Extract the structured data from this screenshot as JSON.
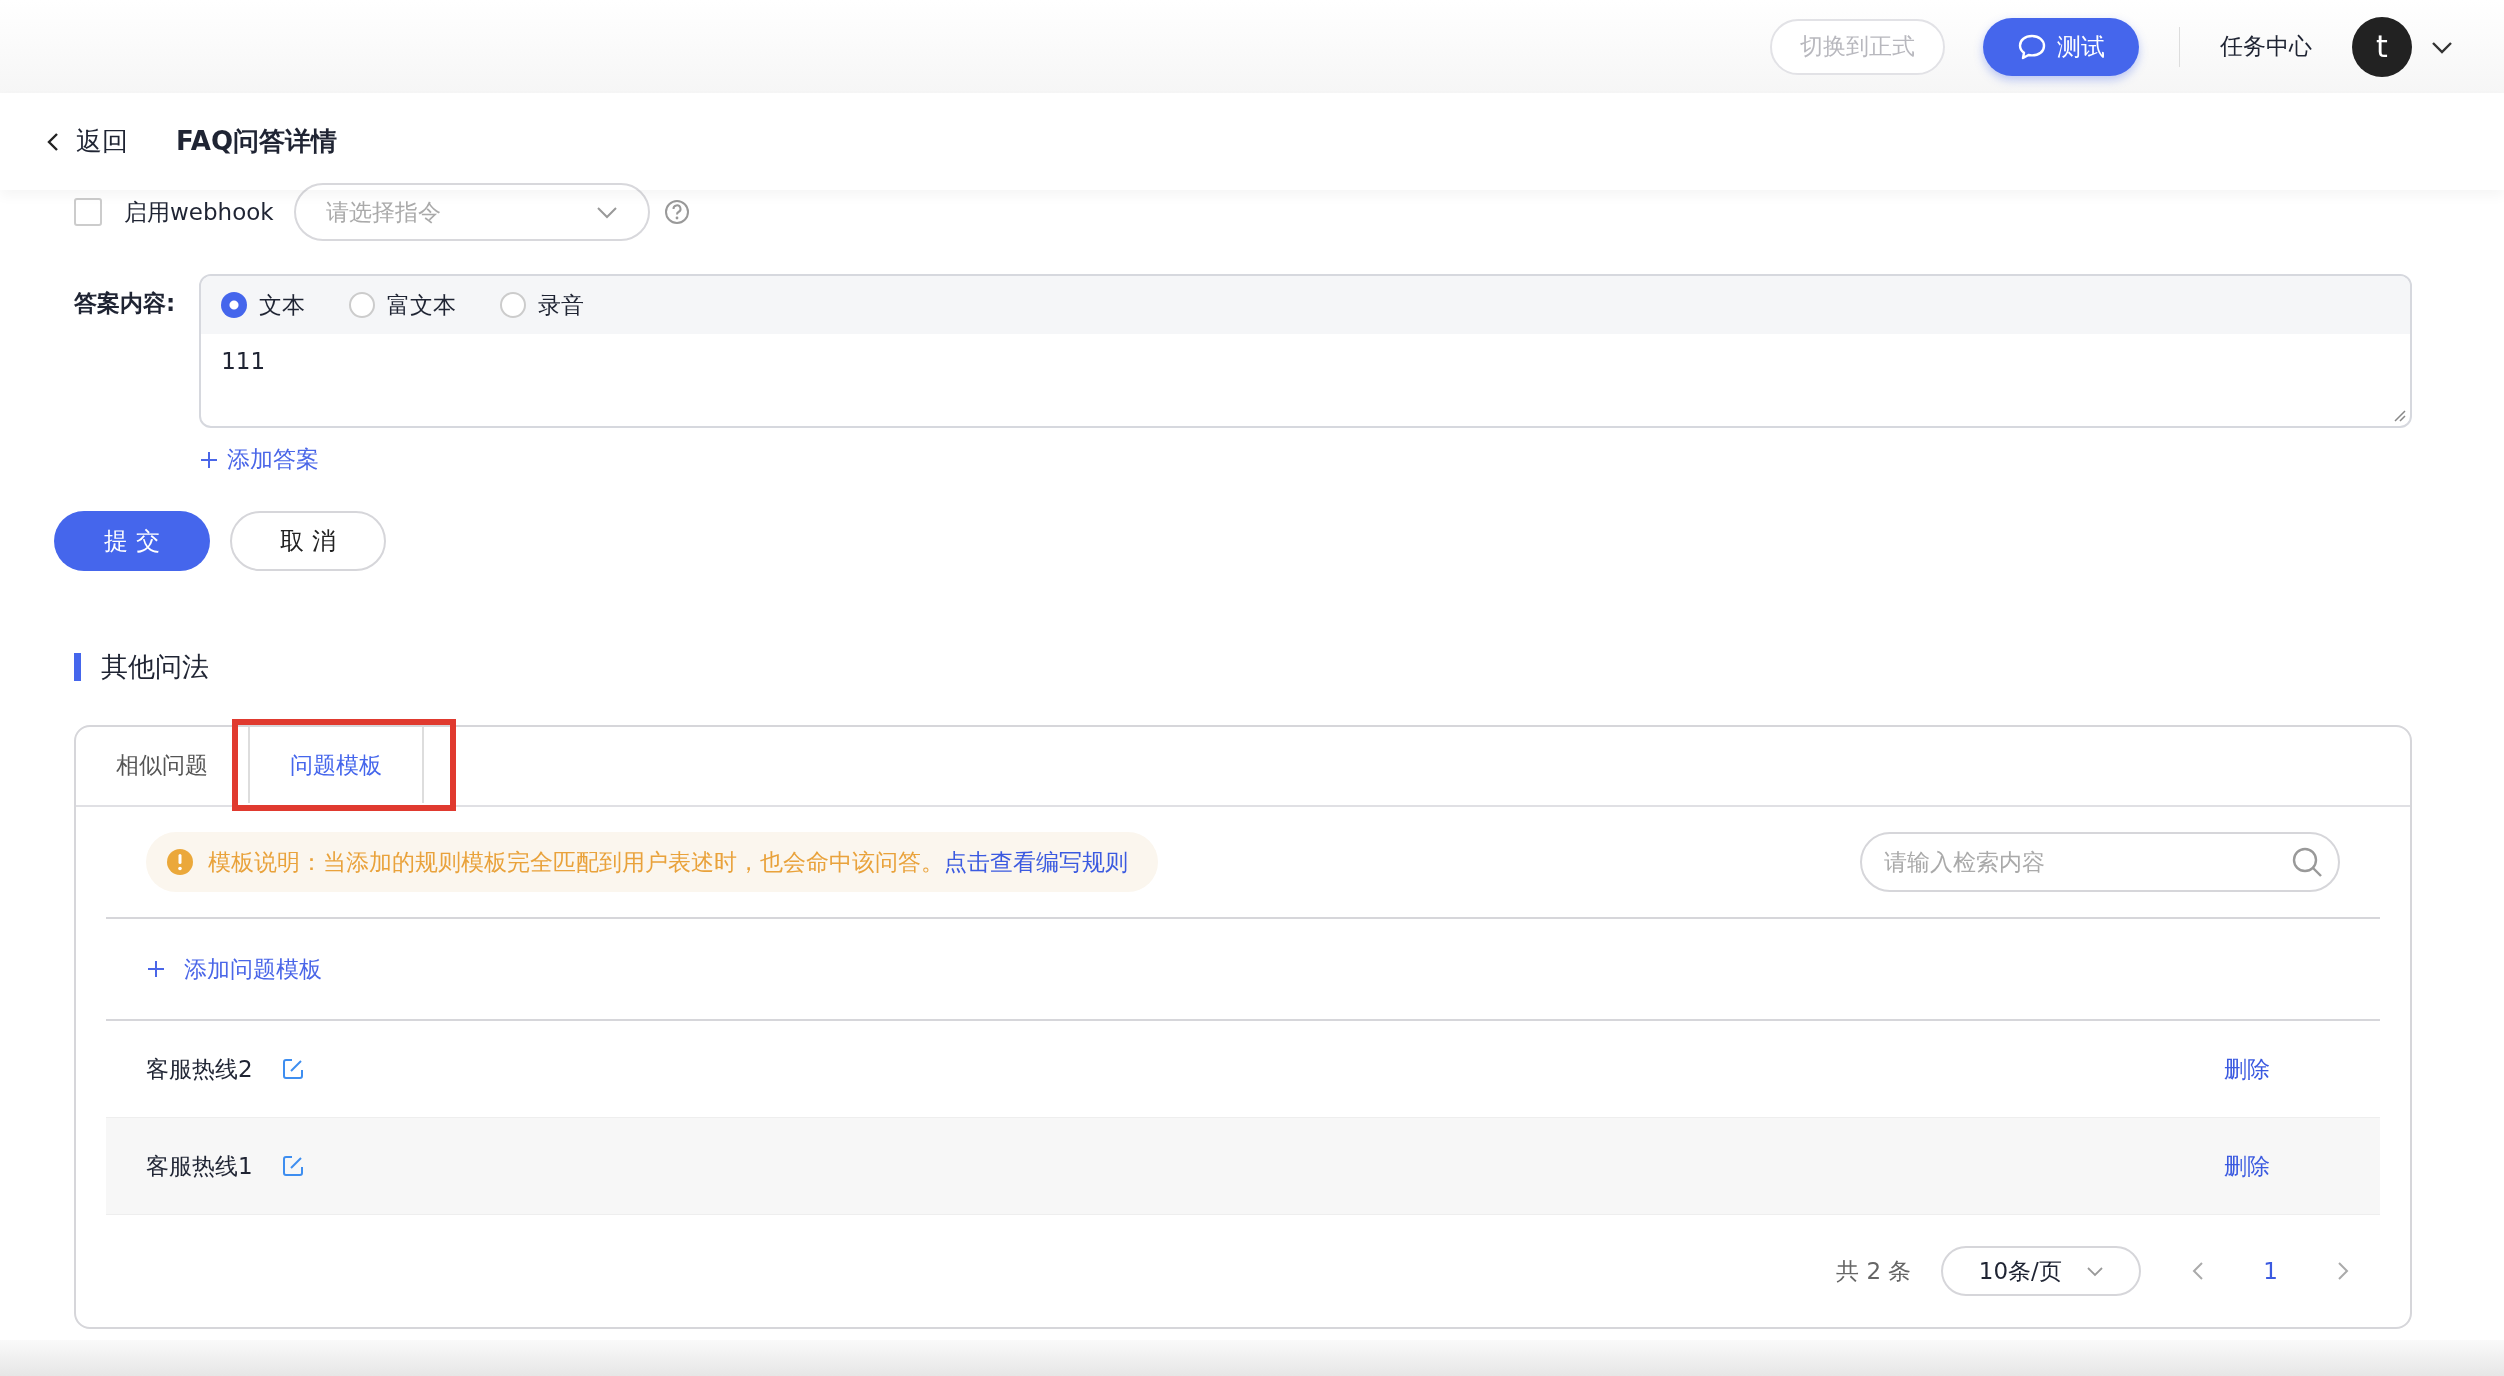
{
  "topbar": {
    "switch_button": "切换到正式",
    "test_button": "测试",
    "task_center": "任务中心",
    "avatar_letter": "t"
  },
  "header": {
    "back": "返回",
    "title": "FAQ问答详情"
  },
  "webhook": {
    "label": "启用webhook",
    "checked": false,
    "select_placeholder": "请选择指令"
  },
  "answer": {
    "label": "答案内容:",
    "types": [
      {
        "label": "文本",
        "selected": true
      },
      {
        "label": "富文本",
        "selected": false
      },
      {
        "label": "录音",
        "selected": false
      }
    ],
    "value": "111",
    "add_answer": "添加答案"
  },
  "actions": [
    "提 交",
    "取 消"
  ],
  "section": {
    "title": "其他问法",
    "tabs": [
      {
        "label": "相似问题",
        "selected": false,
        "highlighted": false
      },
      {
        "label": "问题模板",
        "selected": true,
        "highlighted": true
      }
    ],
    "notice": {
      "text": "模板说明：当添加的规则模板完全匹配到用户表述时，也会命中该问答。",
      "link": "点击查看编写规则"
    },
    "search": {
      "placeholder": "请输入检索内容"
    },
    "add_template": "添加问题模板",
    "rows": [
      {
        "name": "客服热线2",
        "action": "删除"
      },
      {
        "name": "客服热线1",
        "action": "删除"
      }
    ],
    "pagination": {
      "total": "共 2 条",
      "page_size": "10条/页",
      "pages": [
        {
          "label": "1",
          "selected": true
        }
      ]
    }
  }
}
